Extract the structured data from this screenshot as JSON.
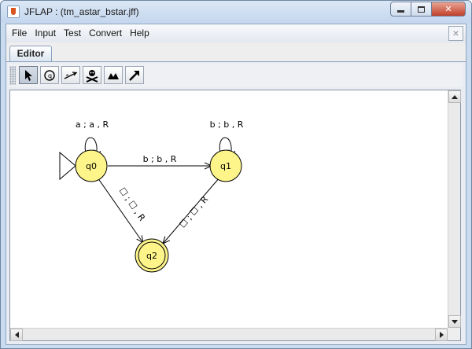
{
  "window": {
    "title": "JFLAP : (tm_astar_bstar.jff)",
    "app_icon": "java-cup-icon",
    "controls": [
      "minimize-icon",
      "maximize-icon",
      "close-icon"
    ]
  },
  "menubar": {
    "items": [
      "File",
      "Input",
      "Test",
      "Convert",
      "Help"
    ],
    "close_glyph": "×"
  },
  "tabs": [
    {
      "label": "Editor",
      "selected": true
    }
  ],
  "toolbar": {
    "tools": [
      {
        "name": "attribute-editor-icon",
        "selected": true
      },
      {
        "name": "state-creator-icon",
        "selected": false
      },
      {
        "name": "transition-creator-icon",
        "selected": false
      },
      {
        "name": "deleter-icon",
        "selected": false
      },
      {
        "name": "undo-icon",
        "selected": false
      },
      {
        "name": "redo-icon",
        "selected": false
      }
    ]
  },
  "automaton": {
    "state_fill": "#fdf58a",
    "states": [
      {
        "id": "q0",
        "label": "q0",
        "initial": true,
        "final": false
      },
      {
        "id": "q1",
        "label": "q1",
        "initial": false,
        "final": false
      },
      {
        "id": "q2",
        "label": "q2",
        "initial": false,
        "final": true
      }
    ],
    "transitions": [
      {
        "from": "q0",
        "to": "q0",
        "label": "a ; a , R"
      },
      {
        "from": "q1",
        "to": "q1",
        "label": "b ; b , R"
      },
      {
        "from": "q0",
        "to": "q1",
        "label": "b ; b , R"
      },
      {
        "from": "q0",
        "to": "q2",
        "label": "☐ ; ☐ , R"
      },
      {
        "from": "q1",
        "to": "q2",
        "label": "☐ ; ☐ , R"
      }
    ]
  }
}
